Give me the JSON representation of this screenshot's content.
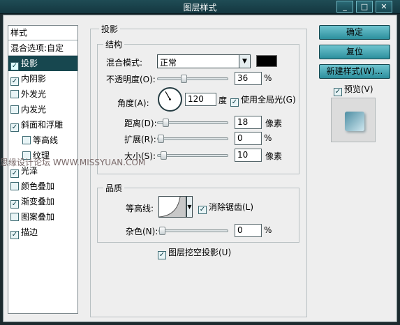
{
  "window": {
    "title": "图层样式"
  },
  "style_list": {
    "header": "样式",
    "blend_options": "混合选项:自定",
    "items": [
      {
        "label": "投影",
        "checked": true,
        "selected": true,
        "sub": false
      },
      {
        "label": "内阴影",
        "checked": true,
        "selected": false,
        "sub": false
      },
      {
        "label": "外发光",
        "checked": false,
        "selected": false,
        "sub": false
      },
      {
        "label": "内发光",
        "checked": false,
        "selected": false,
        "sub": false
      },
      {
        "label": "斜面和浮雕",
        "checked": true,
        "selected": false,
        "sub": false
      },
      {
        "label": "等高线",
        "checked": false,
        "selected": false,
        "sub": true
      },
      {
        "label": "纹理",
        "checked": false,
        "selected": false,
        "sub": true
      },
      {
        "label": "光泽",
        "checked": true,
        "selected": false,
        "sub": false
      },
      {
        "label": "颜色叠加",
        "checked": false,
        "selected": false,
        "sub": false
      },
      {
        "label": "渐变叠加",
        "checked": true,
        "selected": false,
        "sub": false
      },
      {
        "label": "图案叠加",
        "checked": false,
        "selected": false,
        "sub": false
      },
      {
        "label": "描边",
        "checked": true,
        "selected": false,
        "sub": false
      }
    ]
  },
  "shadow_panel": {
    "title": "投影",
    "structure": {
      "title": "结构",
      "blend_mode_label": "混合模式:",
      "blend_mode_value": "正常",
      "shadow_color": "#000000",
      "opacity_label": "不透明度(O):",
      "opacity_value": "36",
      "opacity_unit": "%",
      "angle_label": "角度(A):",
      "angle_value": "120",
      "angle_unit": "度",
      "global_light_label": "使用全局光(G)",
      "global_light_checked": true,
      "distance_label": "距离(D):",
      "distance_value": "18",
      "distance_unit": "像素",
      "spread_label": "扩展(R):",
      "spread_value": "0",
      "spread_unit": "%",
      "size_label": "大小(S):",
      "size_value": "10",
      "size_unit": "像素"
    },
    "quality": {
      "title": "品质",
      "contour_label": "等高线:",
      "antialias_label": "消除锯齿(L)",
      "antialias_checked": true,
      "noise_label": "杂色(N):",
      "noise_value": "0",
      "noise_unit": "%"
    },
    "knockout_label": "图层挖空投影(U)",
    "knockout_checked": true
  },
  "buttons": {
    "ok": "确定",
    "reset": "复位",
    "new_style": "新建样式(W)...",
    "preview_label": "预览(V)",
    "preview_checked": true
  },
  "watermark": "思缘设计论坛  WWW.MISSYUAN.COM"
}
